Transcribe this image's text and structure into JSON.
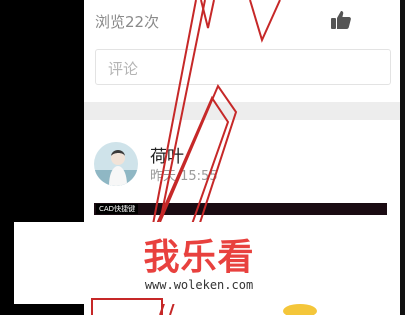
{
  "post": {
    "views_text": "浏览22次"
  },
  "comment": {
    "placeholder": "评论"
  },
  "author": {
    "name": "荷叶",
    "time": "昨天 15:55"
  },
  "thumbnail": {
    "label": "CAD快捷键"
  },
  "watermark": {
    "brand": "我乐看",
    "url": "www.woleken.com"
  },
  "colors": {
    "accent_red": "#e8413e",
    "line_red": "#c62828",
    "text_gray": "#8a8a8a"
  },
  "icons": {
    "like": "thumbs-up-icon",
    "avatar": "avatar"
  }
}
